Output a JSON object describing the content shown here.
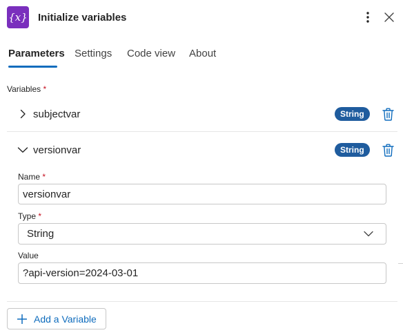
{
  "header": {
    "icon_glyph": "{x}",
    "title": "Initialize variables",
    "more_icon": "more-vertical-icon",
    "close_icon": "close-icon"
  },
  "tabs": [
    {
      "label": "Parameters",
      "active": true
    },
    {
      "label": "Settings",
      "active": false
    },
    {
      "label": "Code view",
      "active": false
    },
    {
      "label": "About",
      "active": false
    }
  ],
  "variables_section": {
    "label": "Variables",
    "required_mark": "*"
  },
  "variables": [
    {
      "name": "subjectvar",
      "type_badge": "String",
      "expanded": false
    },
    {
      "name": "versionvar",
      "type_badge": "String",
      "expanded": true
    }
  ],
  "expanded_form": {
    "name_label": "Name",
    "name_value": "versionvar",
    "type_label": "Type",
    "type_value": "String",
    "value_label": "Value",
    "value_value": "?api-version=2024-03-01",
    "required_mark": "*"
  },
  "add_button": {
    "label": "Add a Variable"
  },
  "colors": {
    "accent": "#0f6cbd",
    "badge": "#1f5c9e",
    "app_icon": "#7a2fbd",
    "required": "#c50f1f"
  }
}
